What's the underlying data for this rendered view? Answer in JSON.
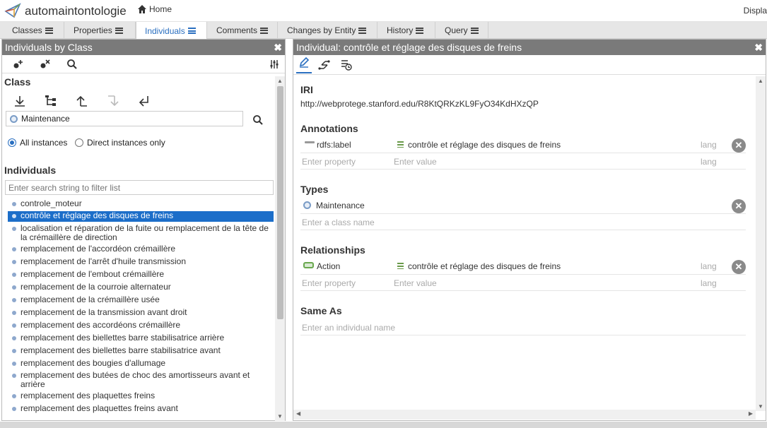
{
  "app": {
    "name": "automaintontologie",
    "home_label": "Home",
    "display_label": "Displa"
  },
  "tabs": [
    {
      "label": "Classes"
    },
    {
      "label": "Properties"
    },
    {
      "label": "Individuals"
    },
    {
      "label": "Comments"
    },
    {
      "label": "Changes by Entity"
    },
    {
      "label": "History"
    },
    {
      "label": "Query"
    }
  ],
  "left_panel": {
    "title": "Individuals by Class",
    "close": "✖",
    "class_section": "Class",
    "class_value": "Maintenance",
    "radio_all": "All instances",
    "radio_direct": "Direct instances only",
    "individuals_section": "Individuals",
    "filter_placeholder": "Enter search string to filter list",
    "items": [
      "controle_moteur",
      "contrôle et réglage des disques de freins",
      "localisation et réparation de la fuite ou remplacement de la tête de la crémaillère de direction",
      "remplacement de l'accordéon crémaillère",
      "remplacement de l'arrêt d'huile transmission",
      "remplacement de l'embout crémaillère",
      "remplacement de la courroie alternateur",
      "remplacement de la crémaillère usée",
      "remplacement de la transmission avant droit",
      "remplacement des accordéons crémaillère",
      "remplacement des biellettes barre stabilisatrice arrière",
      "remplacement des biellettes barre stabilisatrice avant",
      "remplacement des bougies d'allumage",
      "remplacement des butées de choc des amortisseurs avant et arrière",
      "remplacement des plaquettes freins",
      "remplacement des plaquettes freins avant"
    ]
  },
  "right_panel": {
    "title": "Individual: contrôle et réglage des disques de freins",
    "close": "✖",
    "iri_label": "IRI",
    "iri_value": "http://webprotege.stanford.edu/R8KtQRKzKL9FyO34KdHXzQP",
    "annotations_label": "Annotations",
    "annotation": {
      "property": "rdfs:label",
      "value": "contrôle et réglage des disques de freins",
      "lang": "lang"
    },
    "enter_property": "Enter property",
    "enter_value": "Enter value",
    "lang": "lang",
    "types_label": "Types",
    "type_value": "Maintenance",
    "enter_class": "Enter a class name",
    "relationships_label": "Relationships",
    "relationship": {
      "property": "Action",
      "value": "contrôle et réglage des disques de freins",
      "lang": "lang"
    },
    "sameas_label": "Same As",
    "enter_individual": "Enter an individual name"
  }
}
